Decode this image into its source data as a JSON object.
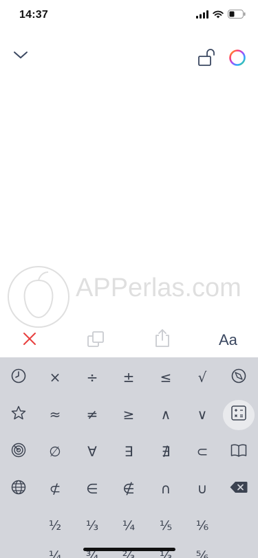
{
  "status_bar": {
    "time": "14:37"
  },
  "icons": {
    "signal": "cellular-signal-icon",
    "wifi": "wifi-icon",
    "battery": "battery-icon",
    "collapse": "chevron-down-icon",
    "lock": "unlock-icon",
    "color": "color-wheel-icon",
    "clear": "close-icon",
    "copy": "copy-icon",
    "share": "share-icon",
    "backspace": "backspace-icon"
  },
  "watermark": {
    "text": "APPerlas.com"
  },
  "action_bar": {
    "font_label": "Aa"
  },
  "keyboard": {
    "row1": [
      "×",
      "÷",
      "±",
      "≤",
      "√"
    ],
    "row2": [
      "≈",
      "≠",
      "≥",
      "∧",
      "∨"
    ],
    "row3": [
      "∅",
      "∀",
      "∃",
      "∄",
      "⊂"
    ],
    "row4": [
      "⊄",
      "∈",
      "∉",
      "∩",
      "∪"
    ],
    "row5": [
      "½",
      "⅓",
      "¼",
      "⅕",
      "⅙"
    ],
    "row6": [
      "¼",
      "¾",
      "⅔",
      "⅓",
      "⅚"
    ]
  },
  "colors": {
    "keyboard_bg": "#d3d5db",
    "clear_red": "#e8403f",
    "accent_blue": "#3a4760"
  }
}
